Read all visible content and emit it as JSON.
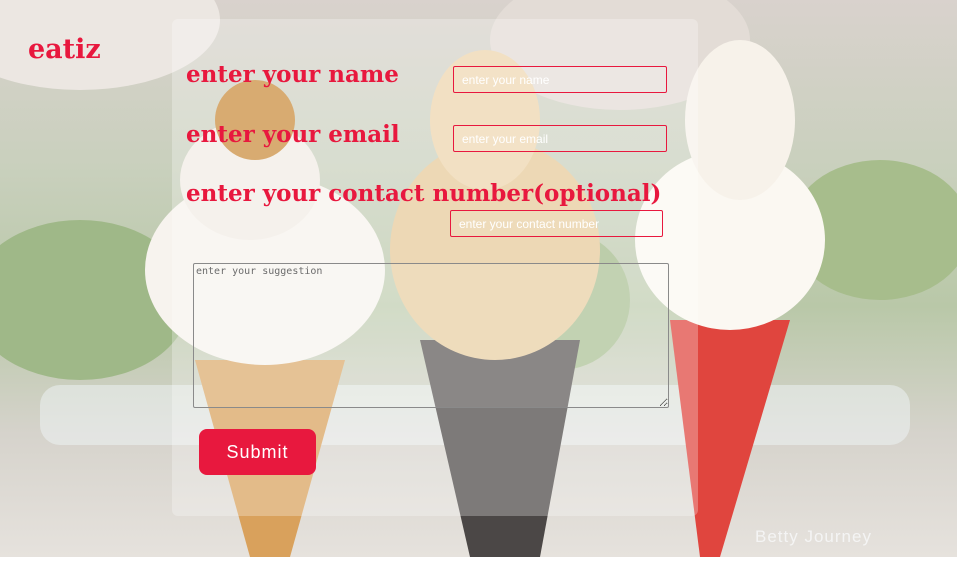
{
  "brand": {
    "logo": "eatiz",
    "accent_color": "#e8183e"
  },
  "form": {
    "name": {
      "label": "enter your name",
      "placeholder": "enter your name"
    },
    "email": {
      "label": "enter your email",
      "placeholder": "enter your email"
    },
    "contact": {
      "label": "enter your contact number(optional)",
      "placeholder": "enter your contact number"
    },
    "suggestion": {
      "placeholder": "enter your suggestion"
    },
    "submit_label": "Submit"
  },
  "background": {
    "description_icon": "ice-cream-photo",
    "watermark": "Betty Journey"
  }
}
